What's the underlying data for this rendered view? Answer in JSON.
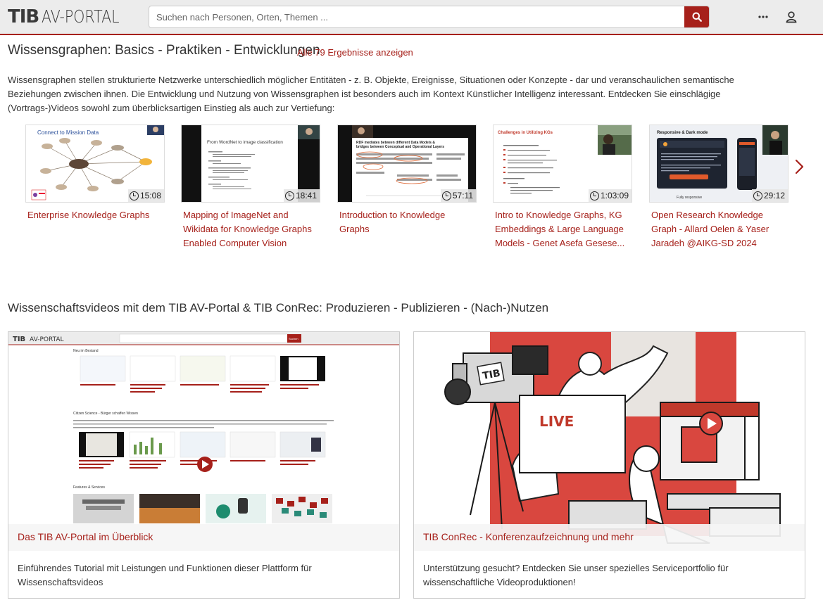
{
  "header": {
    "logo_tib": "TIB",
    "logo_av": "AV-PORTAL",
    "search_placeholder": "Suchen nach Personen, Orten, Themen ...",
    "menu_icon": "more-horizontal-icon",
    "user_icon": "user-icon",
    "accent": "#a6201a"
  },
  "section1": {
    "title": "Wissensgraphen: Basics - Praktiken - Entwicklungen",
    "link": "Alle 79 Ergebnisse anzeigen",
    "description": "Wissensgraphen stellen strukturierte Netzwerke unterschiedlich möglicher Entitäten - z. B. Objekte, Ereignisse, Situationen oder Konzepte - dar und veranschaulichen semantische Beziehungen zwischen ihnen. Die Entwicklung und Nutzung von Wissensgraphen ist besonders auch im Kontext Künstlicher Intelligenz interessant. Entdecken Sie einschlägige (Vortrags-)Videos sowohl zum überblicksartigen Einstieg als auch zur Vertiefung:",
    "videos": [
      {
        "title": "Enterprise Knowledge Graphs",
        "duration": "15:08",
        "slide_title": "Connect to Mission Data"
      },
      {
        "title": "Mapping of ImageNet and Wikidata for Knowledge Graphs Enabled Computer Vision",
        "duration": "18:41",
        "slide_title": "From WordNet to image classification"
      },
      {
        "title": "Introduction to Knowledge Graphs",
        "duration": "57:11",
        "slide_title": "RDF mediates between different Data Models & bridges between Conceptual and Operational Layers"
      },
      {
        "title": "Intro to Knowledge Graphs, KG Embeddings & Large Language Models - Genet Asefa Gesese...",
        "duration": "1:03:09",
        "slide_title": "Challenges in Utilizing KGs"
      },
      {
        "title": "Open Research Knowledge Graph - Allard Oelen & Yaser Jaradeh @AIKG-SD 2024",
        "duration": "29:12",
        "slide_title": "Responsive & Dark mode"
      }
    ],
    "next_icon": "chevron-right-icon"
  },
  "section2": {
    "title": "Wissenschaftsvideos mit dem TIB AV-Portal & TIB ConRec: Produzieren - Publizieren - (Nach-)Nutzen",
    "cards": [
      {
        "label": "Das TIB AV-Portal im Überblick",
        "text": "Einführendes Tutorial mit Leistungen und Funktionen dieser Plattform für Wissenschaftsvideos"
      },
      {
        "label": "TIB ConRec - Konferenzaufzeichnung und mehr",
        "text": "Unterstützung gesucht? Entdecken Sie unser spezielles Serviceportfolio für wissenschaftliche Videoproduktionen!"
      }
    ],
    "mini_screenshot": {
      "search_btn": "Suchen",
      "new_label": "Neu im Bestand",
      "citizen_label": "Citizen Science - Bürger schaffen Wissen",
      "features_label": "Features & Services"
    },
    "illustration_text": {
      "badge": "TIB",
      "live": "LIVE"
    }
  }
}
